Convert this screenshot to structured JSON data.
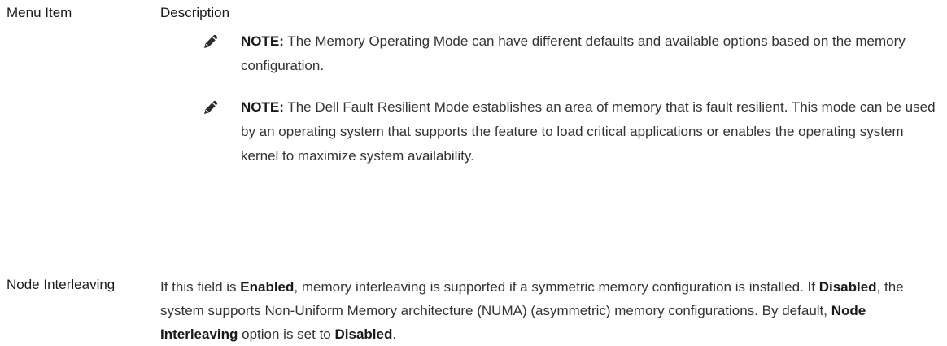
{
  "table": {
    "header": {
      "menu_item": "Menu Item",
      "description": "Description"
    },
    "notes": [
      {
        "icon": "pencil-note-icon",
        "label": "NOTE:",
        "text": " The Memory Operating Mode can have different defaults and available options based on the memory configuration."
      },
      {
        "icon": "pencil-note-icon",
        "label": "NOTE:",
        "text": " The Dell Fault Resilient Mode establishes an area of memory that is fault resilient. This mode can be used by an operating system that supports the feature to load critical applications or enables the operating system kernel to maximize system availability."
      }
    ],
    "row": {
      "label": "Node Interleaving",
      "parts": [
        "If this field is ",
        "Enabled",
        ", memory interleaving is supported if a symmetric memory configuration is installed. If ",
        "Disabled",
        ", the system supports Non-Uniform Memory architecture (NUMA) (asymmetric) memory configurations. By default, ",
        "Node Interleaving",
        " option is set to ",
        "Disabled",
        "."
      ]
    }
  }
}
